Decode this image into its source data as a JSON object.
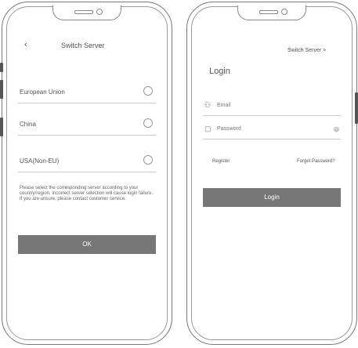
{
  "region_screen": {
    "back_icon": "‹",
    "title": "Switch Server",
    "regions": [
      {
        "label": "European Union",
        "selected": false
      },
      {
        "label": "China",
        "selected": false
      },
      {
        "label": "USA(Non-EU)",
        "selected": false
      }
    ],
    "note": "Please select the corresponding server according to your country/region. Incorrect server selection will cause login failure. If you are unsure, please contact customer service.",
    "ok_label": "OK"
  },
  "login_screen": {
    "switch_link": "Switch Server >",
    "title": "Login",
    "email_icon": "user-icon",
    "email_placeholder": "Email",
    "password_icon": "lock-icon",
    "password_placeholder": "Password",
    "register_link": "Register",
    "forgot_link": "Forget Password?",
    "login_label": "Login"
  }
}
